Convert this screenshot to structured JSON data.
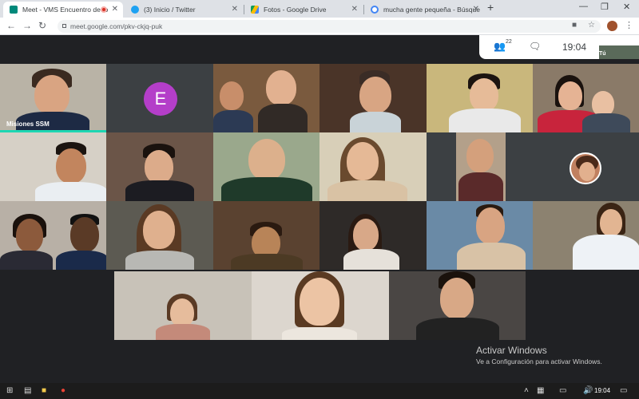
{
  "browser": {
    "tabs": [
      {
        "title": "Meet - VMS Encuentro de fo",
        "active": true,
        "favicon_color": "#00897b"
      },
      {
        "title": "(3) Inicio / Twitter",
        "active": false,
        "favicon_color": "#1da1f2"
      },
      {
        "title": "Fotos - Google Drive",
        "active": false,
        "favicon_color": "#fbbc04"
      },
      {
        "title": "mucha gente pequeña - Búsque",
        "active": false,
        "favicon_color": "#4285f4"
      }
    ],
    "url": "meet.google.com/pkv-ckjq-puk"
  },
  "meet": {
    "participant_count": "22",
    "clock": "19:04",
    "self_label": "Tú",
    "tiles": [
      {
        "label": "Misiones SSM"
      },
      {
        "avatar_letter": "E"
      }
    ]
  },
  "windows": {
    "activate_title": "Activar Windows",
    "activate_sub": "Ve a Configuración para activar Windows."
  },
  "taskbar": {
    "time": "19:04"
  }
}
